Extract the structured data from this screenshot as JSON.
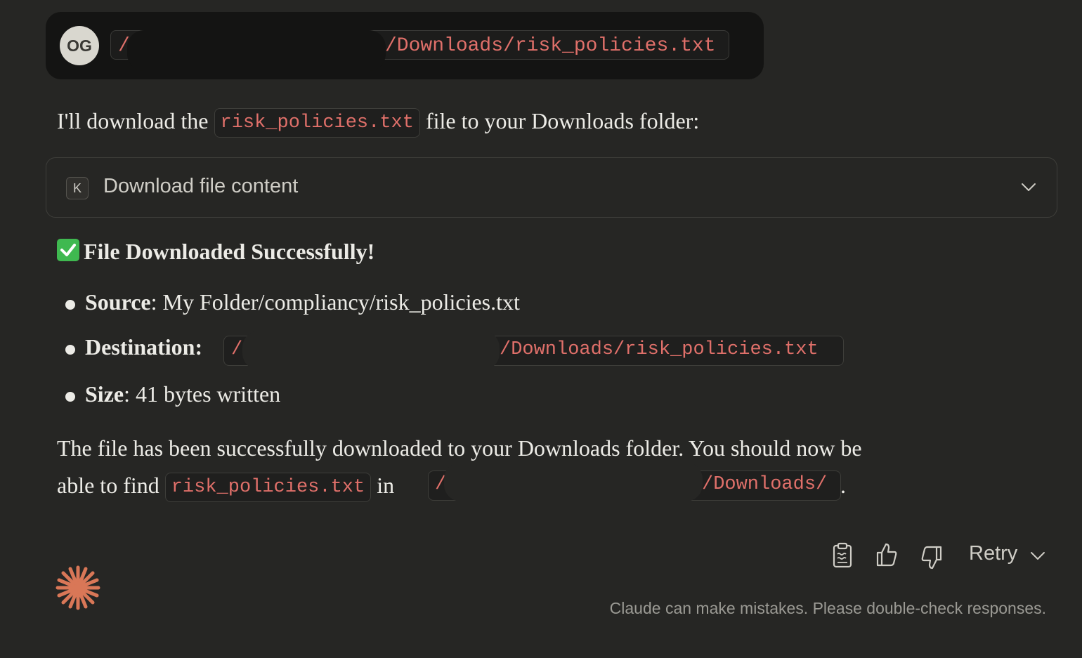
{
  "user_message": {
    "avatar_initials": "OG",
    "path_prefix": "/",
    "path_suffix": "/Downloads/risk_policies.txt"
  },
  "assistant": {
    "intro_before": "I'll download the",
    "intro_code": "risk_policies.txt",
    "intro_after": "file to your Downloads folder:",
    "tool": {
      "icon_letter": "K",
      "label": "Download file content"
    },
    "heading": "File Downloaded Successfully!",
    "items": {
      "source_label": "Source",
      "source_value": ": My Folder/compliancy/risk_policies.txt",
      "destination_label": "Destination",
      "destination_colon": ":",
      "destination_prefix": "/",
      "destination_suffix": "/Downloads/risk_policies.txt",
      "size_label": "Size",
      "size_value": ": 41 bytes written"
    },
    "closing_line1": "The file has been successfully downloaded to your Downloads folder. You should now be",
    "closing_line2_before": "able to find",
    "closing_code1": "risk_policies.txt",
    "closing_in": "in",
    "closing_code2_prefix": "/",
    "closing_code2_suffix": "/Downloads/",
    "closing_period": "."
  },
  "actions": {
    "copy_icon": "clipboard-icon",
    "like_icon": "thumbs-up-icon",
    "dislike_icon": "thumbs-down-icon",
    "retry_label": "Retry"
  },
  "disclaimer": "Claude can make mistakes. Please double-check responses.",
  "colors": {
    "background": "#262624",
    "code_text": "#e0706a",
    "accent": "#d97757"
  }
}
